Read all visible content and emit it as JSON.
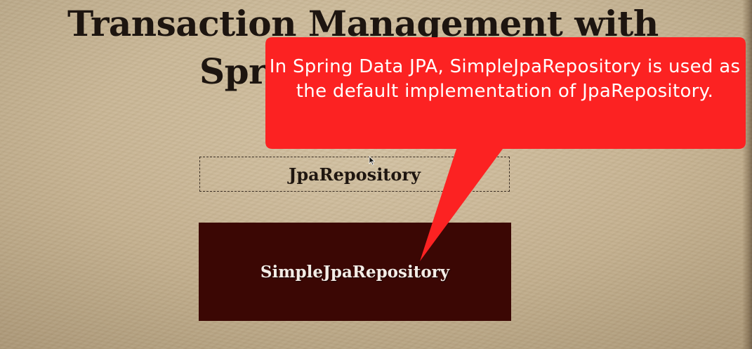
{
  "slide": {
    "title_line_1": "Transaction Management with",
    "title_line_2": "Spr",
    "interface_box": {
      "label": "JpaRepository"
    },
    "implementation_box": {
      "label": "SimpleJpaRepository"
    },
    "callout": {
      "text": "In Spring Data JPA, SimpleJpaRepository is used as the default implementation of JpaRepository.",
      "color": "#fc2222"
    }
  },
  "colors": {
    "background": "#c7b596",
    "title_text": "#1d1510",
    "implementation_fill": "#3b0704",
    "implementation_text": "#f3ece6"
  },
  "icons": {
    "cursor": "mouse-pointer-icon"
  }
}
